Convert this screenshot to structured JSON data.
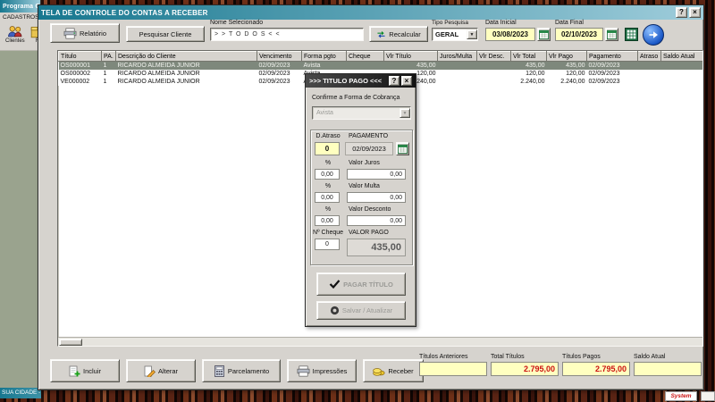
{
  "colors": {
    "titlebar_start": "#17778f",
    "titlebar_end": "#9fcddb",
    "window_bg": "#d6d3ce",
    "field_yellow": "#ffffc0",
    "value_red": "#cc1111",
    "selected_row": "#7e887c",
    "left_app_body": "#9aa38e"
  },
  "desktop": {
    "system_badge": "System"
  },
  "background_app": {
    "title": "Programa C",
    "menu": "CADASTROS",
    "toolbar_items": [
      "Clientes",
      "F"
    ],
    "status_bar": "SUA CIDADE -"
  },
  "window": {
    "title": "TELA DE CONTROLE DO CONTAS A RECEBER",
    "titlebar": {
      "help": "?",
      "close": "×"
    },
    "toolbar": {
      "report_button": "Relatório",
      "search_client_button": "Pesquisar Cliente",
      "selected_name_label": "Nome Selecionado",
      "selected_name_value": "> > T O D O S < <",
      "recalculate_button": "Recalcular",
      "search_type_label": "Tipo  Pesquisa",
      "search_type_value": "GERAL",
      "start_date_label": "Data Inicial",
      "start_date_value": "03/08/2023",
      "end_date_label": "Data Final",
      "end_date_value": "02/10/2023"
    },
    "grid": {
      "columns": [
        "Título",
        "PA.",
        "Descrição do Cliente",
        "Vencimento",
        "Forma pgto",
        "Cheque",
        "Vlr Título",
        "Juros/Multa",
        "Vlr Desc.",
        "Vlr Total",
        "Vlr Pago",
        "Pagamento",
        "Atraso",
        "Saldo Atual"
      ],
      "selected_index": 0,
      "rows": [
        [
          "OS000001",
          "1",
          "RICARDO ALMEIDA JUNIOR",
          "02/09/2023",
          "Avista",
          "",
          "435,00",
          "",
          "",
          "435,00",
          "435,00",
          "02/09/2023",
          "",
          ""
        ],
        [
          "OS000002",
          "1",
          "RICARDO ALMEIDA JUNIOR",
          "02/09/2023",
          "Avista",
          "",
          "120,00",
          "",
          "",
          "120,00",
          "120,00",
          "02/09/2023",
          "",
          ""
        ],
        [
          "VE000002",
          "1",
          "RICARDO ALMEIDA JUNIOR",
          "02/09/2023",
          "Avista",
          "",
          "2.240,00",
          "",
          "",
          "2.240,00",
          "2.240,00",
          "02/09/2023",
          "",
          ""
        ]
      ]
    },
    "footer": {
      "include_button": "Incluir",
      "edit_button": "Alterar",
      "installment_button": "Parcelamento",
      "print_button": "Impressões",
      "receive_button": "Receber",
      "summary": [
        {
          "label": "Títulos Anteriores",
          "value": ""
        },
        {
          "label": "Total Títulos",
          "value": "2.795,00"
        },
        {
          "label": "Títulos Pagos",
          "value": "2.795,00"
        },
        {
          "label": "Saldo Atual",
          "value": ""
        }
      ]
    }
  },
  "dialog": {
    "title": ">>> TITULO PAGO <<<",
    "titlebar": {
      "help": "?",
      "close": "×"
    },
    "confirm_label": "Confirme a Forma de Cobrança",
    "billing_type_value": "Avista",
    "fields": {
      "delay_label": "D.Atraso",
      "delay_value": "0",
      "payment_label": "PAGAMENTO",
      "payment_date": "02/09/2023",
      "juros_pct_label": "%",
      "juros_label": "Valor Juros",
      "juros_pct": "0,00",
      "juros_value": "0,00",
      "multa_pct_label": "%",
      "multa_label": "Valor Multa",
      "multa_pct": "0,00",
      "multa_value": "0,00",
      "desconto_pct_label": "%",
      "desconto_label": "Valor Desconto",
      "desconto_pct": "0,00",
      "desconto_value": "0,00",
      "cheque_label": "Nº Cheque",
      "cheque_value": "0",
      "valor_pago_label": "VALOR PAGO",
      "valor_pago_value": "435,00"
    },
    "pay_button": "PAGAR TÍTULO",
    "save_button": "Salvar / Atualizar"
  }
}
